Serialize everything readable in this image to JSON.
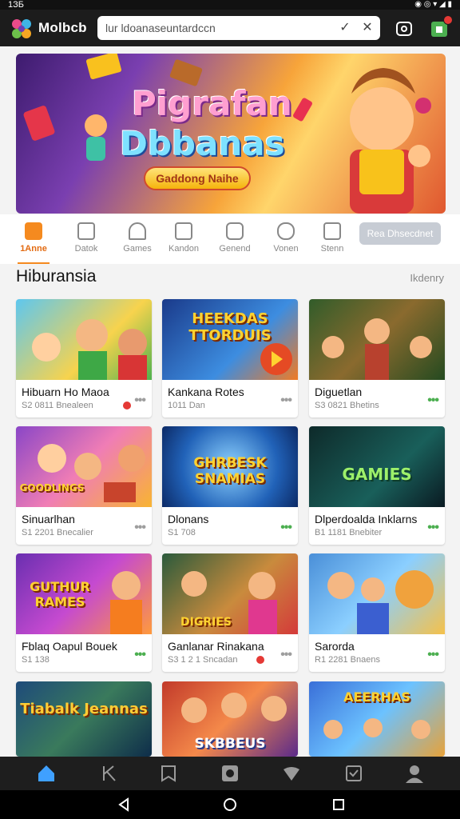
{
  "status": {
    "time": "1ЗБ",
    "right": "◉ ◎ ▾ ◢ ▮"
  },
  "header": {
    "brand": "Molbcb",
    "search_value": "lur ldoanaseuntardccn",
    "icons": [
      "check-icon",
      "close-icon",
      "share-icon",
      "bag-icon"
    ],
    "accent": "#4caf50"
  },
  "hero": {
    "title_line1": "Pigrafan",
    "title_line2": "Dbbanas",
    "cta": "Gaddong Naihe"
  },
  "categories": [
    {
      "label": "1Anne",
      "icon": "home-icon",
      "active": true
    },
    {
      "label": "Datok",
      "icon": "calendar-icon"
    },
    {
      "label": "Games",
      "icon": "bookmark-icon"
    },
    {
      "label": "Kandon",
      "icon": "frame-icon"
    },
    {
      "label": "Genend",
      "icon": "gamepad-icon"
    },
    {
      "label": "Vonen",
      "icon": "heart-icon"
    },
    {
      "label": "Stenn",
      "icon": "folder-icon"
    }
  ],
  "category_button": "Rea Dhsecdnet",
  "section": {
    "title": "Hiburansia",
    "more": "Ikdenry"
  },
  "cards": [
    {
      "title": "Hibuarn Ho Maoa",
      "sub": "S2 0811 Bnealeen",
      "image_text": "",
      "dots_color": "#9e9e9e",
      "red_dot": true
    },
    {
      "title": "Kankana Rotes",
      "sub": "1011 Dan",
      "image_text": "HEEKDAS TTORDUIS",
      "dots_color": "#9e9e9e",
      "red_dot": false
    },
    {
      "title": "Diguetlan",
      "sub": "S3 0821 Bhetins",
      "image_text": "",
      "dots_color": "#4caf50",
      "red_dot": false
    },
    {
      "title": "Sinuarlhan",
      "sub": "S1 2201 Bnecalier",
      "image_text": "GOODLINGS",
      "dots_color": "#9e9e9e",
      "red_dot": false
    },
    {
      "title": "Dlonans",
      "sub": "S1 708",
      "image_text": "GHRBESK SNAMIAS",
      "dots_color": "#4caf50",
      "red_dot": false
    },
    {
      "title": "Dlperdoalda Inklarns",
      "sub": "B1 1181 Bnebiter",
      "image_text": "GAMIES",
      "dots_color": "#4caf50",
      "red_dot": false
    },
    {
      "title": "Fblaq Oapul Bouek",
      "sub": "S1 138",
      "image_text": "GUTHUR RAMES",
      "dots_color": "#4caf50",
      "red_dot": false
    },
    {
      "title": "Ganlanar Rinakana",
      "sub": "S3 1 2 1 Sncadan",
      "image_text": "DIGRIES",
      "dots_color": "#9e9e9e",
      "red_dot": true
    },
    {
      "title": "Sarorda",
      "sub": "R1 2281 Bnaens",
      "image_text": "",
      "dots_color": "#4caf50",
      "red_dot": false
    },
    {
      "title": "",
      "sub": "",
      "image_text": "Tiabalk Jeannas",
      "dots_color": "",
      "red_dot": false
    },
    {
      "title": "",
      "sub": "",
      "image_text": "SKBBEUS",
      "dots_color": "",
      "red_dot": false
    },
    {
      "title": "",
      "sub": "",
      "image_text": "AEERHAS",
      "dots_color": "",
      "red_dot": false
    }
  ],
  "bottom_nav": [
    "home-icon",
    "k-icon",
    "book-icon",
    "image-icon",
    "shield-icon",
    "checklist-icon",
    "profile-icon"
  ]
}
